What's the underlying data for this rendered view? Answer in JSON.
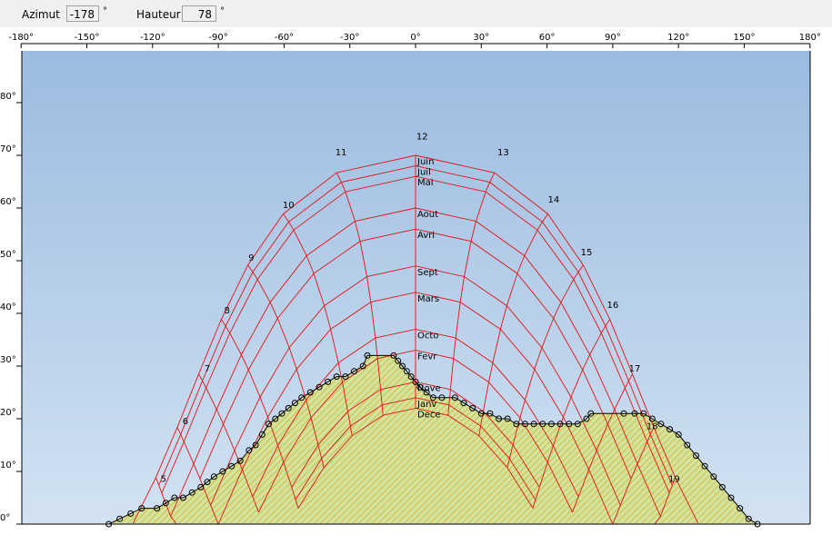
{
  "toolbar": {
    "azimut_label": "Azimut",
    "azimut_value": "-178",
    "azimut_unit": "°",
    "hauteur_label": "Hauteur",
    "hauteur_value": "78",
    "hauteur_unit": "°"
  },
  "axis": {
    "azimuth_ticks": [
      -180,
      -150,
      -120,
      -90,
      -60,
      -30,
      0,
      30,
      60,
      90,
      120,
      150,
      180
    ],
    "azimuth_tick_labels": [
      "-180°",
      "-150°",
      "-120°",
      "-90°",
      "-60°",
      "-30°",
      "0°",
      "30°",
      "60°",
      "90°",
      "120°",
      "150°",
      "180°"
    ],
    "altitude_ticks": [
      0,
      10,
      20,
      30,
      40,
      50,
      60,
      70,
      80
    ],
    "altitude_tick_labels": [
      "0°",
      "10°",
      "20°",
      "30°",
      "40°",
      "50°",
      "60°",
      "70°",
      "80°"
    ]
  },
  "colors": {
    "sun_lines": "#e01414",
    "mask_lines": "#000000",
    "mask_fill": "#cfe4a0",
    "mask_hatch": "#e0b020",
    "sky_top": "#9bbbe0",
    "sky_bottom": "#d2e2f2"
  },
  "chart_data": {
    "type": "sun-path-diagram",
    "xlabel": "",
    "ylabel": "",
    "xlim": [
      -180,
      180
    ],
    "ylim": [
      0,
      90
    ],
    "months": [
      {
        "name": "Juin",
        "alt": 70
      },
      {
        "name": "Juil",
        "alt": 68
      },
      {
        "name": "Mai",
        "alt": 66
      },
      {
        "name": "Aout",
        "alt": 60
      },
      {
        "name": "Avri",
        "alt": 56
      },
      {
        "name": "Sept",
        "alt": 49
      },
      {
        "name": "Mars",
        "alt": 44
      },
      {
        "name": "Octo",
        "alt": 37
      },
      {
        "name": "Fevr",
        "alt": 33
      },
      {
        "name": "Nove",
        "alt": 27
      },
      {
        "name": "Janv",
        "alt": 24
      },
      {
        "name": "Dece",
        "alt": 22
      }
    ],
    "hours": [
      {
        "label": "5",
        "az": -115,
        "alt": 8
      },
      {
        "label": "6",
        "az": -105,
        "alt": 19
      },
      {
        "label": "7",
        "az": -95,
        "alt": 29
      },
      {
        "label": "8",
        "az": -86,
        "alt": 40
      },
      {
        "label": "9",
        "az": -75,
        "alt": 50
      },
      {
        "label": "10",
        "az": -58,
        "alt": 60
      },
      {
        "label": "11",
        "az": -34,
        "alt": 70
      },
      {
        "label": "12",
        "az": 3,
        "alt": 73
      },
      {
        "label": "13",
        "az": 40,
        "alt": 70
      },
      {
        "label": "14",
        "az": 63,
        "alt": 61
      },
      {
        "label": "15",
        "az": 78,
        "alt": 51
      },
      {
        "label": "16",
        "az": 90,
        "alt": 41
      },
      {
        "label": "17",
        "az": 100,
        "alt": 29
      },
      {
        "label": "18",
        "az": 108,
        "alt": 18
      },
      {
        "label": "19",
        "az": 118,
        "alt": 8
      }
    ],
    "horizon_mask": [
      [
        -140,
        0
      ],
      [
        -135,
        1
      ],
      [
        -130,
        2
      ],
      [
        -125,
        3
      ],
      [
        -118,
        3
      ],
      [
        -114,
        4
      ],
      [
        -110,
        5
      ],
      [
        -106,
        5
      ],
      [
        -102,
        6
      ],
      [
        -98,
        7
      ],
      [
        -95,
        8
      ],
      [
        -92,
        9
      ],
      [
        -88,
        10
      ],
      [
        -84,
        11
      ],
      [
        -80,
        12
      ],
      [
        -76,
        14
      ],
      [
        -73,
        15
      ],
      [
        -70,
        17
      ],
      [
        -67,
        19
      ],
      [
        -64,
        20
      ],
      [
        -61,
        21
      ],
      [
        -58,
        22
      ],
      [
        -55,
        23
      ],
      [
        -52,
        24
      ],
      [
        -48,
        25
      ],
      [
        -44,
        26
      ],
      [
        -40,
        27
      ],
      [
        -36,
        28
      ],
      [
        -32,
        28
      ],
      [
        -28,
        29
      ],
      [
        -24,
        30
      ],
      [
        -22,
        32
      ],
      [
        -10,
        32
      ],
      [
        -8,
        31
      ],
      [
        -6,
        30
      ],
      [
        -4,
        29
      ],
      [
        -2,
        28
      ],
      [
        0,
        27
      ],
      [
        2,
        26
      ],
      [
        5,
        25
      ],
      [
        8,
        24
      ],
      [
        12,
        24
      ],
      [
        18,
        24
      ],
      [
        22,
        23
      ],
      [
        26,
        22
      ],
      [
        30,
        21
      ],
      [
        34,
        21
      ],
      [
        38,
        20
      ],
      [
        42,
        20
      ],
      [
        46,
        19
      ],
      [
        50,
        19
      ],
      [
        54,
        19
      ],
      [
        58,
        19
      ],
      [
        62,
        19
      ],
      [
        66,
        19
      ],
      [
        70,
        19
      ],
      [
        74,
        19
      ],
      [
        78,
        20
      ],
      [
        80,
        21
      ],
      [
        95,
        21
      ],
      [
        100,
        21
      ],
      [
        104,
        21
      ],
      [
        108,
        20
      ],
      [
        112,
        19
      ],
      [
        116,
        18
      ],
      [
        120,
        17
      ],
      [
        124,
        15
      ],
      [
        128,
        13
      ],
      [
        132,
        11
      ],
      [
        136,
        9
      ],
      [
        140,
        7
      ],
      [
        144,
        5
      ],
      [
        148,
        3
      ],
      [
        152,
        1
      ],
      [
        156,
        0
      ]
    ]
  }
}
